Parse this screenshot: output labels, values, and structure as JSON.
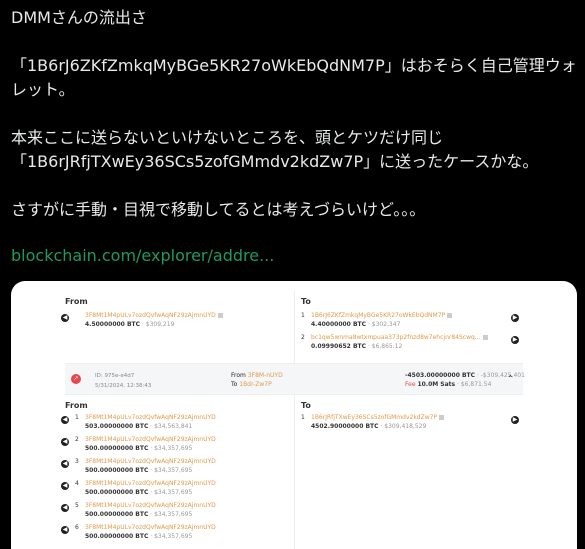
{
  "post": {
    "line1": "DMMさんの流出さ",
    "line2": "「1B6rJ6ZKfZmkqMyBGe5KR27oWkEbQdNM7P」はおそらく自己管理ウォ",
    "line3": "レット。",
    "line4": "本来ここに送らないといけないところを、頭とケツだけ同じ",
    "line5": "「1B6rJRfjTXwEy36SCs5zofGMmdv2kdZw7P」に送ったケースかな。",
    "line6": "さすがに手動・目視で移動してるとは考えづらいけど。。。",
    "link": "blockchain.com/explorer/addre..."
  },
  "card": {
    "from_label": "From",
    "to_label": "To",
    "top_from": {
      "addr": "3F8Mt1M4pULv7ozdQvfwAqNF29zAjmnUYD",
      "amount": "4.50000000 BTC",
      "usd": "· $309,219"
    },
    "top_to": [
      {
        "idx": "1",
        "addr": "1B6rJ6ZKfZmkqMyBGe5KR27oWkEbQdNM7P",
        "amount": "4.40000000 BTC",
        "usd": "· $302,347"
      },
      {
        "idx": "2",
        "addr": "bc1qw5wnma8wtxmpuaa373p2fnzd8w7ehcjnr84Scwq...",
        "amount": "0.09990652 BTC",
        "usd": "· $6,865.12"
      }
    ],
    "tx": {
      "id": "ID: 975e-e4d7",
      "date": "5/31/2024, 12:38:43",
      "from_label": "From",
      "from_val": "3F8M-nUYD",
      "to_label": "To",
      "to_val": "1Bdr-Zw7P",
      "amount": "-4503.00000000 BTC",
      "amount_usd": "· -$309,425,401",
      "fee_label": "Fee",
      "fee_val": "10.0M Sats",
      "fee_usd": "· $6,871.54"
    },
    "bottom_from": [
      {
        "idx": "1",
        "addr": "3F8Mt1M4pULv7ozdQvfwAqNF29zAjmnUYD",
        "amount": "503.00000000 BTC",
        "usd": "· $34,563,841"
      },
      {
        "idx": "2",
        "addr": "3F8Mt1M4pULv7ozdQvfwAqNF29zAjmnUYD",
        "amount": "500.00000000 BTC",
        "usd": "· $34,357,695"
      },
      {
        "idx": "3",
        "addr": "3F8Mt1M4pULv7ozdQvfwAqNF29zAjmnUYD",
        "amount": "500.00000000 BTC",
        "usd": "· $34,357,695"
      },
      {
        "idx": "4",
        "addr": "3F8Mt1M4pULv7ozdQvfwAqNF29zAjmnUYD",
        "amount": "500.00000000 BTC",
        "usd": "· $34,357,695"
      },
      {
        "idx": "5",
        "addr": "3F8Mt1M4pULv7ozdQvfwAqNF29zAjmnUYD",
        "amount": "500.00000000 BTC",
        "usd": "· $34,357,695"
      },
      {
        "idx": "6",
        "addr": "3F8Mt1M4pULv7ozdQvfwAqNF29zAjmnUYD",
        "amount": "500.00000000 BTC",
        "usd": "· $34,357,695"
      }
    ],
    "bottom_to": {
      "idx": "1",
      "addr": "1B6rJRfjTXwEy36SCs5zofGMmdv2kdZw7P",
      "amount": "4502.90000000 BTC",
      "usd": "· $309,418,529"
    }
  }
}
